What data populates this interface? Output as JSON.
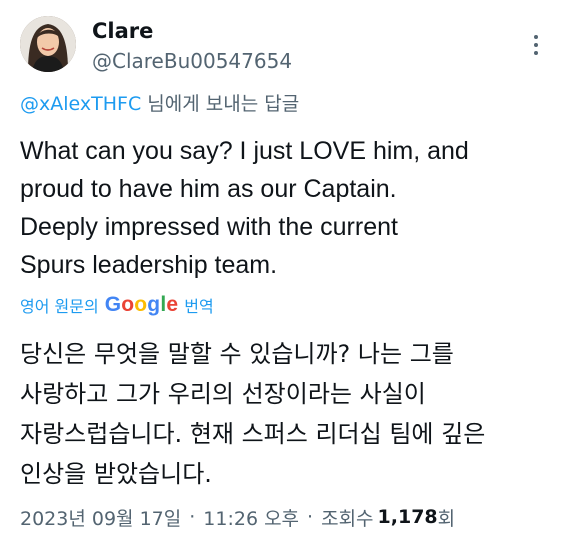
{
  "user": {
    "name": "Clare",
    "handle": "@ClareBu00547654"
  },
  "reply": {
    "mention": "@xAlexTHFC",
    "suffix": " 님에게 보내는 답글"
  },
  "tweet": {
    "lines": [
      "What can you say? I just LOVE him, and",
      "proud to have him as our Captain.",
      "Deeply impressed with the current",
      "Spurs leadership team."
    ]
  },
  "translate": {
    "prefix": "영어 원문의",
    "brand": "Google",
    "suffix": "번역"
  },
  "translated": {
    "lines": [
      "당신은 무엇을 말할 수 있습니까? 나는 그를",
      "사랑하고 그가 우리의 선장이라는 사실이",
      "자랑스럽습니다. 현재 스퍼스 리더십 팀에 깊은",
      "인상을 받았습니다."
    ]
  },
  "meta": {
    "date": "2023년 09월 17일",
    "time": "11:26 오후",
    "views_label": "조회수",
    "views_count": "1,178",
    "views_suffix": "회"
  },
  "icons": {
    "more": "more-vertical-icon"
  },
  "colors": {
    "accent": "#1d9bf0",
    "text": "#0f1419",
    "muted": "#536471"
  }
}
